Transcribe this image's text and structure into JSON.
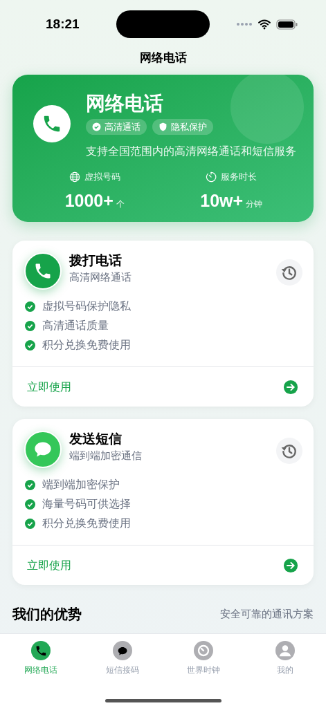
{
  "status_bar": {
    "time": "18:21"
  },
  "nav": {
    "title": "网络电话"
  },
  "hero": {
    "title": "网络电话",
    "badges": [
      {
        "kind": "check",
        "label": "高清通话"
      },
      {
        "kind": "shield",
        "label": "隐私保护"
      }
    ],
    "description": "支持全国范围内的高清网络通话和短信服务",
    "stats": [
      {
        "kind": "globe",
        "label": "虚拟号码",
        "value": "1000+",
        "unit": "个"
      },
      {
        "kind": "timer",
        "label": "服务时长",
        "value": "10w+",
        "unit": "分钟"
      }
    ]
  },
  "services": [
    {
      "kind": "call",
      "color": "#16a34a",
      "title": "拨打电话",
      "subtitle": "高清网络通话",
      "features": [
        "虚拟号码保护隐私",
        "高清通话质量",
        "积分兑换免费使用"
      ],
      "action": "立即使用"
    },
    {
      "kind": "sms",
      "color": "#34c759",
      "title": "发送短信",
      "subtitle": "端到端加密通信",
      "features": [
        "端到端加密保护",
        "海量号码可供选择",
        "积分兑换免费使用"
      ],
      "action": "立即使用"
    }
  ],
  "advantages": {
    "title": "我们的优势",
    "subtitle": "安全可靠的通讯方案"
  },
  "tab_bar": [
    {
      "kind": "call",
      "label": "网络电话",
      "selected": true
    },
    {
      "kind": "sms",
      "label": "短信接码",
      "selected": false
    },
    {
      "kind": "clock",
      "label": "世界时钟",
      "selected": false
    },
    {
      "kind": "person",
      "label": "我的",
      "selected": false
    }
  ]
}
